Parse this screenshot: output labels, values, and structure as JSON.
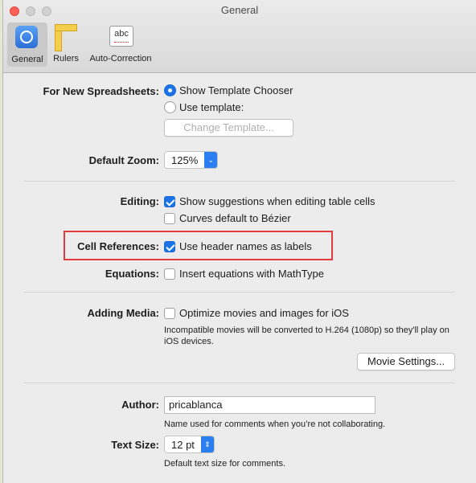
{
  "window": {
    "title": "General"
  },
  "toolbar": {
    "general_label": "General",
    "rulers_label": "Rulers",
    "autocorrection_label": "Auto-Correction",
    "abc_text": "abc"
  },
  "spreadsheets": {
    "label": "For New Spreadsheets:",
    "show_chooser": "Show Template Chooser",
    "use_template": "Use template:",
    "change_template": "Change Template...",
    "selected": "Show Template Chooser"
  },
  "zoom": {
    "label": "Default Zoom:",
    "value": "125%"
  },
  "editing": {
    "label": "Editing:",
    "suggestions": "Show suggestions when editing table cells",
    "suggestions_checked": true,
    "curves": "Curves default to Bézier",
    "curves_checked": false
  },
  "cell_references": {
    "label": "Cell References:",
    "header_names": "Use header names as labels",
    "checked": true
  },
  "equations": {
    "label": "Equations:",
    "mathtype": "Insert equations with MathType",
    "checked": false
  },
  "media": {
    "label": "Adding Media:",
    "optimize": "Optimize movies and images for iOS",
    "checked": false,
    "note": "Incompatible movies will be converted to H.264 (1080p) so they'll play on iOS devices.",
    "movie_settings": "Movie Settings..."
  },
  "author": {
    "label": "Author:",
    "value": "pricablanca",
    "note": "Name used for comments when you’re not collaborating."
  },
  "text_size": {
    "label": "Text Size:",
    "value": "12 pt",
    "note": "Default text size for comments."
  },
  "colors": {
    "accent": "#1a73e8",
    "highlight": "#e03a3a"
  }
}
